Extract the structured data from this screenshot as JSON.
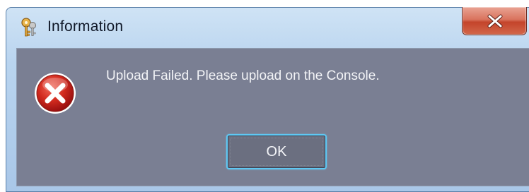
{
  "window": {
    "title": "Information",
    "icons": {
      "app": "keys-icon",
      "close": "close-icon",
      "status": "error-icon"
    }
  },
  "dialog": {
    "message": "Upload Failed. Please upload on the Console.",
    "ok_label": "OK"
  },
  "colors": {
    "titlebar": "#b9d4ef",
    "client_background": "#7a7f93",
    "close_button": "#c4442b",
    "ok_focus_border": "#5fc8f3",
    "error_red": "#c81e1e"
  }
}
